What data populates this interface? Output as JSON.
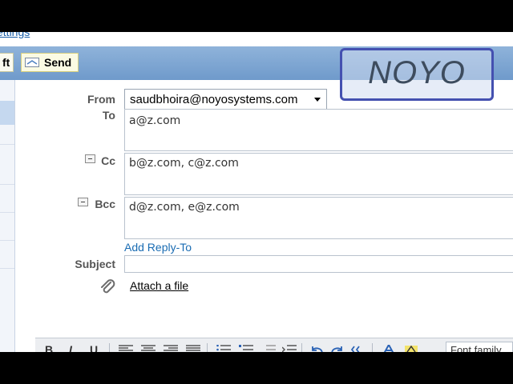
{
  "header": {
    "settings_link": "ettings",
    "draft_label": "ft",
    "send_label": "Send"
  },
  "logo": {
    "text": "NOYO"
  },
  "form": {
    "from": {
      "label": "From",
      "value": "saudbhoira@noyosystems.com"
    },
    "to": {
      "label": "To",
      "value": "a@z.com"
    },
    "cc": {
      "label": "Cc",
      "value": "b@z.com, c@z.com"
    },
    "bcc": {
      "label": "Bcc",
      "value": "d@z.com, e@z.com"
    },
    "add_reply_to": "Add Reply-To",
    "subject": {
      "label": "Subject",
      "value": ""
    },
    "attach_label": "Attach a file"
  },
  "editor_toolbar": {
    "bold": "B",
    "italic": "I",
    "underline": "U",
    "font_family": "Font family"
  },
  "icons": [
    "send-icon",
    "collapse-icon",
    "paperclip-icon"
  ],
  "colors": {
    "toolbar": "#7fa7d3",
    "link": "#1a6cb3",
    "logo_border": "#4450b0"
  }
}
